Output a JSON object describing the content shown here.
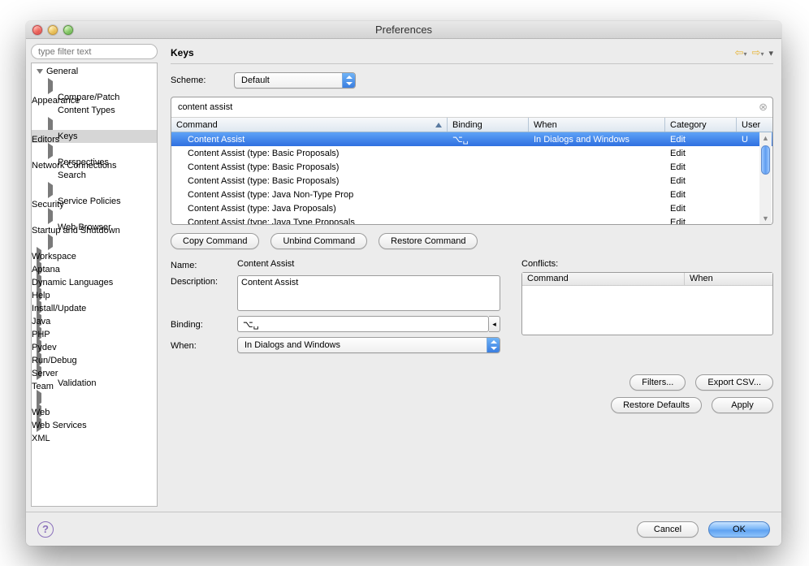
{
  "window": {
    "title": "Preferences"
  },
  "sidebar": {
    "filter_placeholder": "type filter text",
    "nodes": [
      {
        "label": "General",
        "depth": 0,
        "kind": "down"
      },
      {
        "label": "Appearance",
        "depth": 1,
        "kind": "right"
      },
      {
        "label": "Compare/Patch",
        "depth": 1,
        "kind": "none"
      },
      {
        "label": "Content Types",
        "depth": 1,
        "kind": "none"
      },
      {
        "label": "Editors",
        "depth": 1,
        "kind": "right"
      },
      {
        "label": "Keys",
        "depth": 1,
        "kind": "none",
        "selected": true
      },
      {
        "label": "Network Connections",
        "depth": 1,
        "kind": "right"
      },
      {
        "label": "Perspectives",
        "depth": 1,
        "kind": "none"
      },
      {
        "label": "Search",
        "depth": 1,
        "kind": "none"
      },
      {
        "label": "Security",
        "depth": 1,
        "kind": "right"
      },
      {
        "label": "Service Policies",
        "depth": 1,
        "kind": "none"
      },
      {
        "label": "Startup and Shutdown",
        "depth": 1,
        "kind": "right"
      },
      {
        "label": "Web Browser",
        "depth": 1,
        "kind": "none"
      },
      {
        "label": "Workspace",
        "depth": 1,
        "kind": "right"
      },
      {
        "label": "Aptana",
        "depth": 0,
        "kind": "right"
      },
      {
        "label": "Dynamic Languages",
        "depth": 0,
        "kind": "right"
      },
      {
        "label": "Help",
        "depth": 0,
        "kind": "right"
      },
      {
        "label": "Install/Update",
        "depth": 0,
        "kind": "right"
      },
      {
        "label": "Java",
        "depth": 0,
        "kind": "right"
      },
      {
        "label": "PHP",
        "depth": 0,
        "kind": "right"
      },
      {
        "label": "Pydev",
        "depth": 0,
        "kind": "right"
      },
      {
        "label": "Run/Debug",
        "depth": 0,
        "kind": "right"
      },
      {
        "label": "Server",
        "depth": 0,
        "kind": "right"
      },
      {
        "label": "Team",
        "depth": 0,
        "kind": "right"
      },
      {
        "label": "Validation",
        "depth": 1,
        "kind": "none"
      },
      {
        "label": "Web",
        "depth": 0,
        "kind": "right"
      },
      {
        "label": "Web Services",
        "depth": 0,
        "kind": "right"
      },
      {
        "label": "XML",
        "depth": 0,
        "kind": "right"
      }
    ]
  },
  "panel": {
    "title": "Keys",
    "scheme_label": "Scheme:",
    "scheme_value": "Default",
    "search_value": "content assist",
    "columns": {
      "command": "Command",
      "binding": "Binding",
      "when": "When",
      "category": "Category",
      "user": "User"
    },
    "rows": [
      {
        "command": "Content Assist",
        "binding": "⌥␣",
        "when": "In Dialogs and Windows",
        "category": "Edit",
        "user": "U",
        "selected": true
      },
      {
        "command": "Content Assist (type: Basic Proposals)",
        "binding": "",
        "when": "",
        "category": "Edit",
        "user": ""
      },
      {
        "command": "Content Assist (type: Basic Proposals)",
        "binding": "",
        "when": "",
        "category": "Edit",
        "user": ""
      },
      {
        "command": "Content Assist (type: Basic Proposals)",
        "binding": "",
        "when": "",
        "category": "Edit",
        "user": ""
      },
      {
        "command": "Content Assist (type: Java Non-Type Prop",
        "binding": "",
        "when": "",
        "category": "Edit",
        "user": ""
      },
      {
        "command": "Content Assist (type: Java Proposals)",
        "binding": "",
        "when": "",
        "category": "Edit",
        "user": ""
      },
      {
        "command": "Content Assist (type: Java Type Proposals",
        "binding": "",
        "when": "",
        "category": "Edit",
        "user": ""
      }
    ],
    "buttons": {
      "copy": "Copy Command",
      "unbind": "Unbind Command",
      "restore": "Restore Command",
      "filters": "Filters...",
      "export": "Export CSV...",
      "restore_defaults": "Restore Defaults",
      "apply": "Apply",
      "cancel": "Cancel",
      "ok": "OK"
    },
    "detail": {
      "name_label": "Name:",
      "name_value": "Content Assist",
      "description_label": "Description:",
      "description_value": "Content Assist",
      "binding_label": "Binding:",
      "binding_value": "⌥␣",
      "when_label": "When:",
      "when_value": "In Dialogs and Windows",
      "conflicts_label": "Conflicts:",
      "conflicts_cols": {
        "command": "Command",
        "when": "When"
      }
    }
  }
}
